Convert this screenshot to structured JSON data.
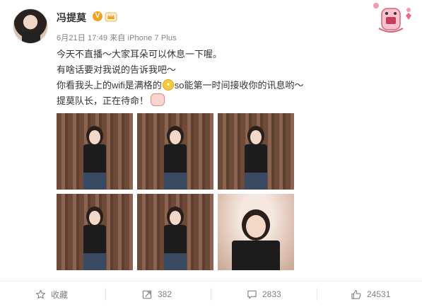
{
  "post": {
    "username": "冯提莫",
    "verified_badge": "V",
    "meta": "6月21日 17:49 来自 iPhone 7 Plus",
    "lines": [
      "今天不直播～大家耳朵可以休息一下喔。",
      "有啥话要对我说的告诉我吧～",
      "你看我头上的wifi是满格的",
      "so能第一时间接收你的讯息哟～",
      "提莫队长，正在待命！"
    ],
    "emoji": [
      "fear-face-emoji",
      "rabbit-sticker-emoji"
    ]
  },
  "photos": [
    {
      "name": "photo-1"
    },
    {
      "name": "photo-2"
    },
    {
      "name": "photo-3"
    },
    {
      "name": "photo-4"
    },
    {
      "name": "photo-5"
    },
    {
      "name": "photo-6"
    }
  ],
  "actions": {
    "favorite": {
      "label": "收藏",
      "icon": "star-icon"
    },
    "repost": {
      "count": "382",
      "icon": "repost-icon"
    },
    "comment": {
      "count": "2833",
      "icon": "comment-icon"
    },
    "like": {
      "count": "24531",
      "icon": "thumbs-up-icon"
    }
  },
  "colors": {
    "text": "#333333",
    "meta": "#808080",
    "badge": "#f4a21c",
    "divider": "#eaeaea"
  }
}
